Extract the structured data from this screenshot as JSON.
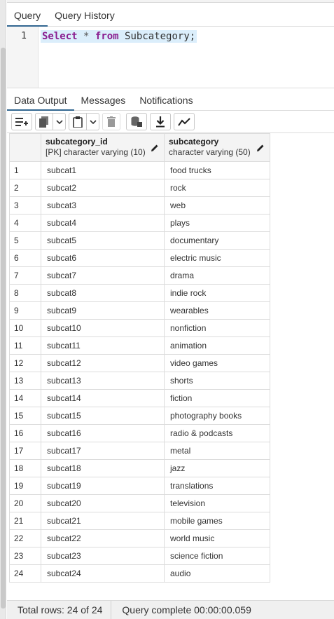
{
  "query_tabs": [
    {
      "label": "Query",
      "active": true
    },
    {
      "label": "Query History",
      "active": false
    }
  ],
  "editor": {
    "line_number": "1",
    "tokens": {
      "select": "Select",
      "star": "*",
      "from": "from",
      "table": "Subcategory;"
    }
  },
  "results_tabs": [
    {
      "label": "Data Output",
      "active": true
    },
    {
      "label": "Messages",
      "active": false
    },
    {
      "label": "Notifications",
      "active": false
    }
  ],
  "toolbar_icons": [
    "add-row-icon",
    "copy-icon",
    "chevron-down-icon",
    "paste-icon",
    "chevron-down-icon",
    "delete-icon",
    "save-data-icon",
    "download-icon",
    "graph-icon"
  ],
  "grid": {
    "columns": [
      {
        "name": "subcategory_id",
        "type": "[PK] character varying (10)"
      },
      {
        "name": "subcategory",
        "type": "character varying (50)"
      }
    ],
    "rows": [
      {
        "n": "1",
        "id": "subcat1",
        "name": "food trucks"
      },
      {
        "n": "2",
        "id": "subcat2",
        "name": "rock"
      },
      {
        "n": "3",
        "id": "subcat3",
        "name": "web"
      },
      {
        "n": "4",
        "id": "subcat4",
        "name": "plays"
      },
      {
        "n": "5",
        "id": "subcat5",
        "name": "documentary"
      },
      {
        "n": "6",
        "id": "subcat6",
        "name": "electric music"
      },
      {
        "n": "7",
        "id": "subcat7",
        "name": "drama"
      },
      {
        "n": "8",
        "id": "subcat8",
        "name": "indie rock"
      },
      {
        "n": "9",
        "id": "subcat9",
        "name": "wearables"
      },
      {
        "n": "10",
        "id": "subcat10",
        "name": "nonfiction"
      },
      {
        "n": "11",
        "id": "subcat11",
        "name": "animation"
      },
      {
        "n": "12",
        "id": "subcat12",
        "name": "video games"
      },
      {
        "n": "13",
        "id": "subcat13",
        "name": "shorts"
      },
      {
        "n": "14",
        "id": "subcat14",
        "name": "fiction"
      },
      {
        "n": "15",
        "id": "subcat15",
        "name": "photography books"
      },
      {
        "n": "16",
        "id": "subcat16",
        "name": "radio & podcasts"
      },
      {
        "n": "17",
        "id": "subcat17",
        "name": "metal"
      },
      {
        "n": "18",
        "id": "subcat18",
        "name": "jazz"
      },
      {
        "n": "19",
        "id": "subcat19",
        "name": "translations"
      },
      {
        "n": "20",
        "id": "subcat20",
        "name": "television"
      },
      {
        "n": "21",
        "id": "subcat21",
        "name": "mobile games"
      },
      {
        "n": "22",
        "id": "subcat22",
        "name": "world music"
      },
      {
        "n": "23",
        "id": "subcat23",
        "name": "science fiction"
      },
      {
        "n": "24",
        "id": "subcat24",
        "name": "audio"
      }
    ]
  },
  "status": {
    "total_rows": "Total rows: 24 of 24",
    "query_complete": "Query complete 00:00:00.059"
  },
  "colors": {
    "keyword": "#8a1d8f",
    "active_tab_underline": "#326690",
    "code_highlight": "#dbeefb"
  }
}
